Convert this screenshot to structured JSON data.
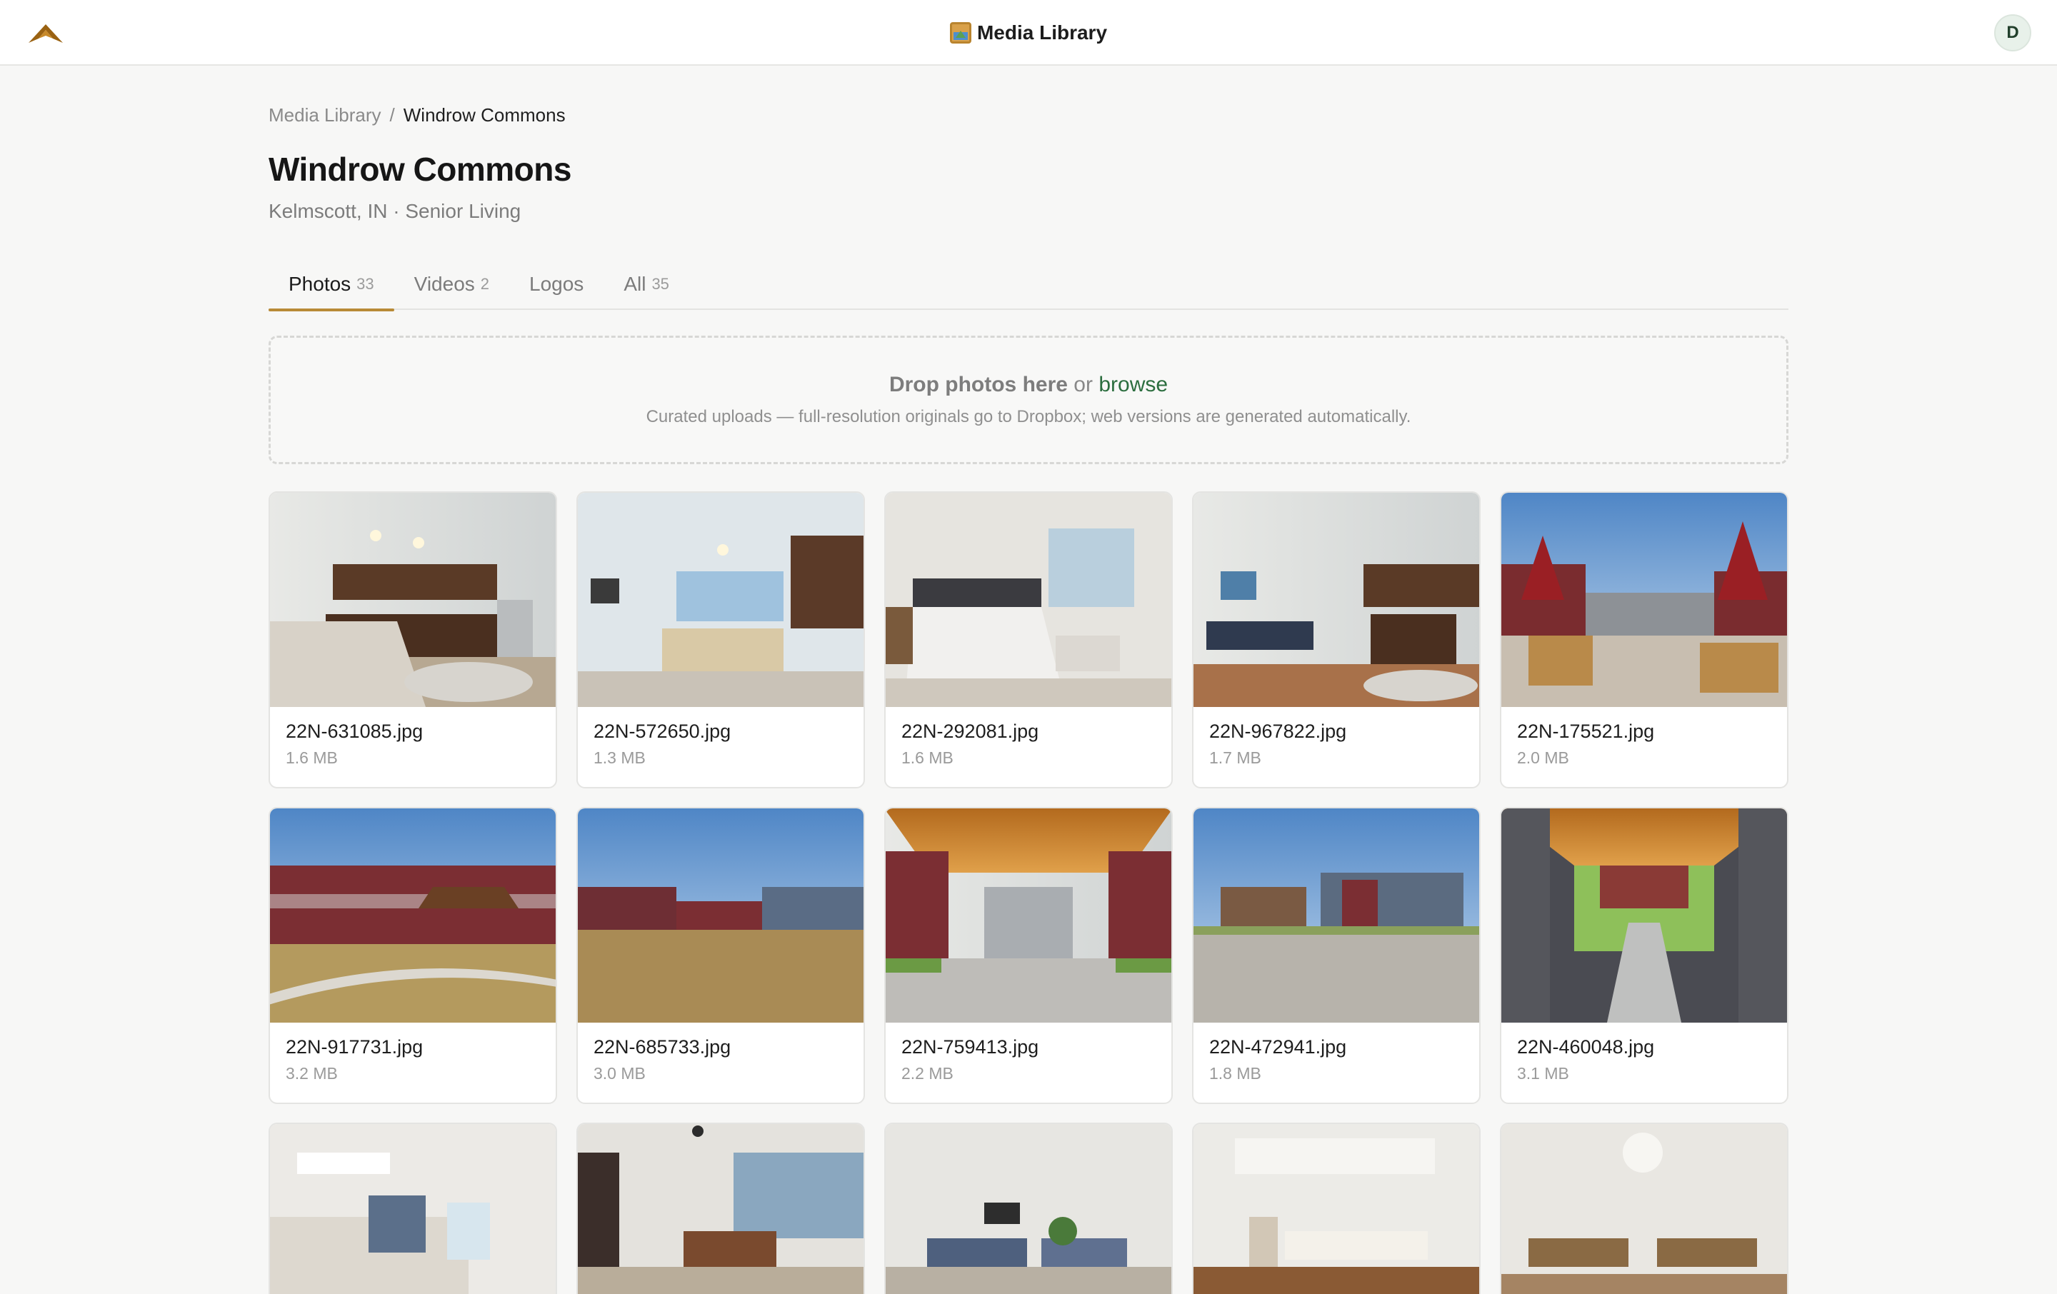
{
  "header": {
    "logo_icon": "mountain-logo-icon",
    "title": "Media Library",
    "title_icon": "framed-picture-icon",
    "avatar_initial": "D"
  },
  "breadcrumb": {
    "root": "Media Library",
    "separator": "/",
    "current": "Windrow Commons"
  },
  "page": {
    "title": "Windrow Commons",
    "subtitle": "Kelmscott, IN · Senior Living"
  },
  "tabs": [
    {
      "label": "Photos",
      "count": "33",
      "active": true
    },
    {
      "label": "Videos",
      "count": "2",
      "active": false
    },
    {
      "label": "Logos",
      "count": "",
      "active": false
    },
    {
      "label": "All",
      "count": "35",
      "active": false
    }
  ],
  "dropzone": {
    "strong": "Drop photos here",
    "connector": "or",
    "browse": "browse",
    "note": "Curated uploads — full-resolution originals go to Dropbox; web versions are generated automatically."
  },
  "photos": [
    {
      "name": "22N-631085.jpg",
      "size": "1.6 MB",
      "scene": "kitchen"
    },
    {
      "name": "22N-572650.jpg",
      "size": "1.3 MB",
      "scene": "living-kitchen"
    },
    {
      "name": "22N-292081.jpg",
      "size": "1.6 MB",
      "scene": "bedroom"
    },
    {
      "name": "22N-967822.jpg",
      "size": "1.7 MB",
      "scene": "open-living"
    },
    {
      "name": "22N-175521.jpg",
      "size": "2.0 MB",
      "scene": "patio-umbrellas"
    },
    {
      "name": "22N-917731.jpg",
      "size": "3.2 MB",
      "scene": "courtyard-pavilion"
    },
    {
      "name": "22N-685733.jpg",
      "size": "3.0 MB",
      "scene": "courtyard-lawn"
    },
    {
      "name": "22N-759413.jpg",
      "size": "2.2 MB",
      "scene": "breezeway"
    },
    {
      "name": "22N-472941.jpg",
      "size": "1.8 MB",
      "scene": "building-exterior"
    },
    {
      "name": "22N-460048.jpg",
      "size": "3.1 MB",
      "scene": "brick-walkway"
    },
    {
      "name": "",
      "size": "",
      "scene": "reception-desk"
    },
    {
      "name": "",
      "size": "",
      "scene": "lobby"
    },
    {
      "name": "",
      "size": "",
      "scene": "lounge"
    },
    {
      "name": "",
      "size": "",
      "scene": "dining-hall"
    },
    {
      "name": "",
      "size": "",
      "scene": "dining-room"
    }
  ]
}
